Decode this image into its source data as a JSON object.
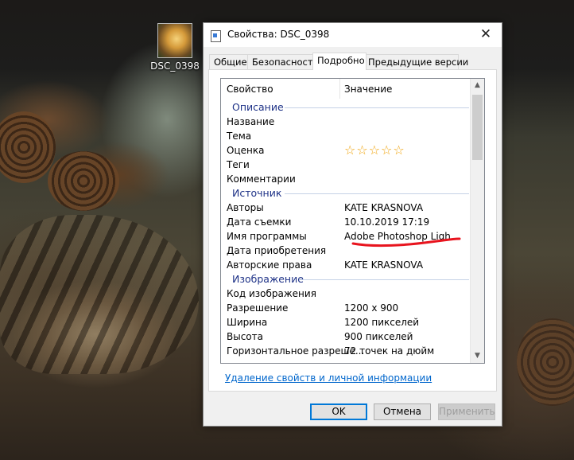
{
  "desktop": {
    "icon_label": "DSC_0398"
  },
  "dialog": {
    "title": "Свойства: DSC_0398",
    "close_glyph": "✕",
    "tabs": [
      {
        "label": "Общие"
      },
      {
        "label": "Безопасность"
      },
      {
        "label": "Подробно"
      },
      {
        "label": "Предыдущие версии"
      }
    ],
    "active_tab": "Подробно",
    "list": {
      "col_property": "Свойство",
      "col_value": "Значение",
      "groups": {
        "description": "Описание",
        "source": "Источник",
        "image": "Изображение"
      },
      "rows": {
        "title": {
          "k": "Название",
          "v": ""
        },
        "subject": {
          "k": "Тема",
          "v": ""
        },
        "rating": {
          "k": "Оценка",
          "v": "☆☆☆☆☆",
          "value": 0,
          "max": 5
        },
        "tags": {
          "k": "Теги",
          "v": ""
        },
        "comments": {
          "k": "Комментарии",
          "v": ""
        },
        "authors": {
          "k": "Авторы",
          "v": "KATE KRASNOVA"
        },
        "date_taken": {
          "k": "Дата съемки",
          "v": "10.10.2019 17:19"
        },
        "program": {
          "k": "Имя программы",
          "v": "Adobe Photoshop Ligh..."
        },
        "date_acquired": {
          "k": "Дата приобретения",
          "v": ""
        },
        "copyright": {
          "k": "Авторские права",
          "v": "KATE KRASNOVA"
        },
        "image_id": {
          "k": "Код изображения",
          "v": ""
        },
        "dimensions": {
          "k": "Разрешение",
          "v": "1200 x 900"
        },
        "width": {
          "k": "Ширина",
          "v": "1200 пикселей"
        },
        "height": {
          "k": "Высота",
          "v": "900 пикселей"
        },
        "h_resolution": {
          "k": "Горизонтальное разреше...",
          "v": "72 точек на дюйм"
        }
      }
    },
    "remove_link": "Удаление свойств и личной информации",
    "buttons": {
      "ok": "OK",
      "cancel": "Отмена",
      "apply": "Применить"
    },
    "colors": {
      "group_heading": "#1e3287",
      "stars": "#f0a30a",
      "annotation": "#e8141e",
      "link": "#0066cc",
      "focus_border": "#0078d7"
    }
  }
}
